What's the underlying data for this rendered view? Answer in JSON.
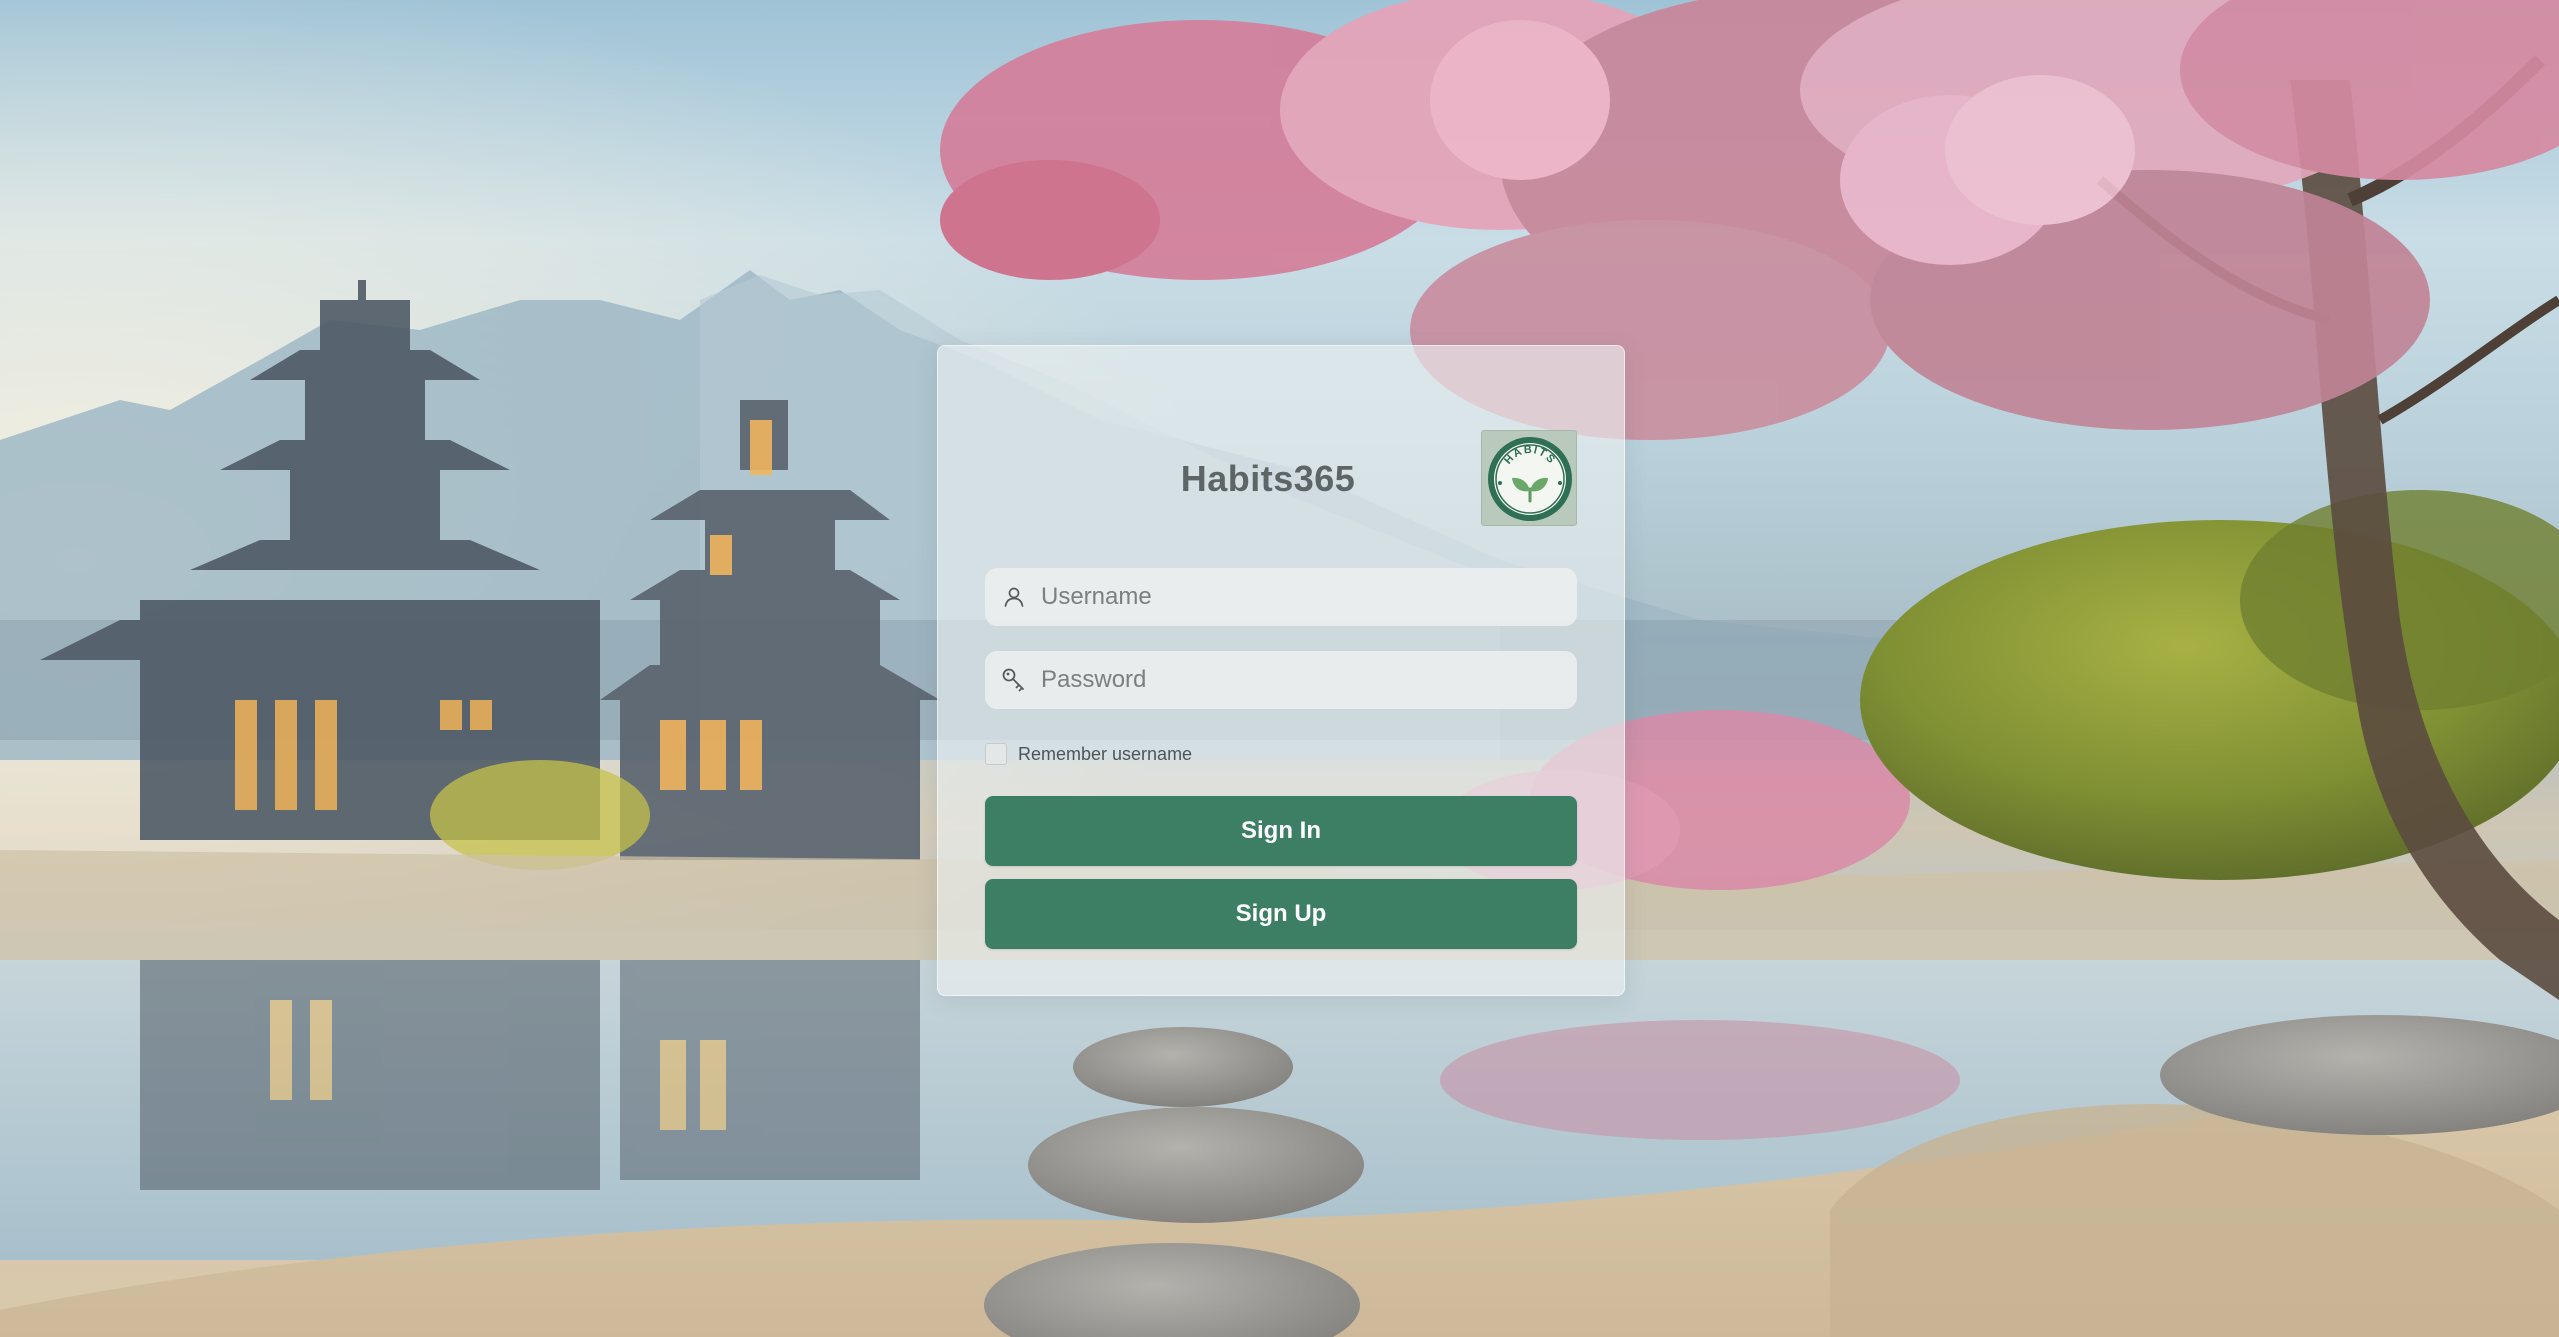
{
  "app": {
    "title": "Habits365"
  },
  "logo": {
    "text": "HABITS",
    "icon": "sprout-leaf-icon"
  },
  "form": {
    "username": {
      "placeholder": "Username",
      "value": "",
      "icon": "user-icon"
    },
    "password": {
      "placeholder": "Password",
      "value": "",
      "icon": "key-icon"
    },
    "remember_label": "Remember username",
    "remember_checked": false,
    "signin_label": "Sign In",
    "signup_label": "Sign Up"
  },
  "colors": {
    "button": "#3c7f65",
    "logo_green": "#2f6f53"
  }
}
